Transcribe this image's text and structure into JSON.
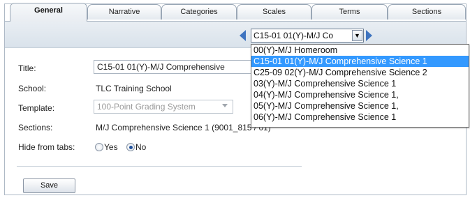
{
  "tabs": [
    {
      "label": "General",
      "active": true
    },
    {
      "label": "Narrative",
      "active": false
    },
    {
      "label": "Categories",
      "active": false
    },
    {
      "label": "Scales",
      "active": false
    },
    {
      "label": "Terms",
      "active": false
    },
    {
      "label": "Sections",
      "active": false
    }
  ],
  "nav": {
    "section_combo_value": "C15-01 01(Y)-M/J Co",
    "combo_button_glyph": "▼",
    "options": [
      {
        "label": "00(Y)-M/J Homeroom",
        "selected": false
      },
      {
        "label": "C15-01 01(Y)-M/J Comprehensive Science 1",
        "selected": true
      },
      {
        "label": "C25-09 02(Y)-M/J Comprehensive Science 2",
        "selected": false
      },
      {
        "label": "03(Y)-M/J Comprehensive Science 1",
        "selected": false
      },
      {
        "label": "04(Y)-M/J Comprehensive Science 1,",
        "selected": false
      },
      {
        "label": "05(Y)-M/J Comprehensive Science 1,",
        "selected": false
      },
      {
        "label": "06(Y)-M/J Comprehensive Science 1",
        "selected": false
      }
    ]
  },
  "form": {
    "title_label": "Title:",
    "title_value": "C15-01 01(Y)-M/J Comprehensive",
    "school_label": "School:",
    "school_value": "TLC Training School",
    "template_label": "Template:",
    "template_value": "100-Point Grading System",
    "sections_label": "Sections:",
    "sections_value": "M/J Comprehensive Science 1 (9001_815 / 01)",
    "hide_label": "Hide from tabs:",
    "hide_yes": "Yes",
    "hide_no": "No",
    "hide_selected": "No",
    "save_label": "Save"
  },
  "colors": {
    "accent": "#3f74c0",
    "selection": "#3399ff",
    "nav_band": "#dde5ed"
  }
}
